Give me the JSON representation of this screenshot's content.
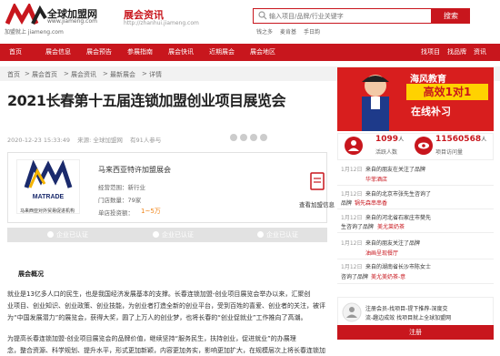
{
  "header": {
    "logo_text": "全球加盟网",
    "logo_url": "www.jiameng.com",
    "slogan": "加盟就上 jiameng.com",
    "section_title": "展会资讯",
    "section_url": "http://zhanhui.jiameng.com",
    "search_placeholder": "输入项目/品牌/行业关键字",
    "search_button": "搜索",
    "hot_keywords": [
      "钱之多",
      "麦肯基",
      "手日韵"
    ]
  },
  "nav": {
    "items": [
      "首页",
      "展会信息",
      "展会预告",
      "参展指南",
      "展会快讯",
      "近期展会",
      "展会地区"
    ],
    "right_items": [
      "找项目",
      "找品牌",
      "资讯"
    ]
  },
  "breadcrumb": [
    "首页",
    "展会首页",
    "展会资讯",
    "最新展会",
    "详情"
  ],
  "article": {
    "title": "2021长春第十五届连锁加盟创业项目展览会",
    "date": "2020-12-23 15:33:49",
    "source": "来源: 全球加盟网",
    "views": "有91人参与"
  },
  "company": {
    "name": "马来西亚特许加盟展会",
    "industry": "经营范围：新行业",
    "stores": "门店数量：79家",
    "invest_label": "单店投资额：",
    "invest_value": "1~5万",
    "logo_caption": "马来西亚对外贸易促进机构",
    "logo_word": "MATRADE",
    "view_info": "查看加盟信息"
  },
  "tabs": [
    "企业已认证",
    "企业已认证",
    "企业已认证"
  ],
  "overview": {
    "heading": "展会概况",
    "para1": [
      "就业是13亿多人口的民生，也是我国经济发展基本的支撑。长春连锁加盟-创业项目展览会举办以来，汇聚创",
      "业项目、创业知识、创业政策、创业技能，为创业者打造全新的创业平台，受到百姓的喜爱、创业者的关注，被评",
      "为“中国发展潜力”的展览会，获得大奖，圆了上万人的创业梦，也将长春的“创业促就业”工作推向了高潮。"
    ],
    "para2": [
      "为提高长春连锁加盟-创业项目展览会的品牌价值，继续坚持“服务民生，扶持创业，促进就业”的办展理",
      "念，整合资源、科学规划、提升水平，形式更加新颖，内容更加务实，影响更加扩大，在规模层次上将长春连锁加"
    ]
  },
  "sidebar": {
    "ad": {
      "line1": "海风教育",
      "line2": "高效1对1",
      "line3": "在线补习"
    },
    "stats": [
      {
        "value": "1099",
        "unit": "人",
        "label": "活跃人数"
      },
      {
        "value": "11560568",
        "unit": "人",
        "label": "项目访问量"
      }
    ],
    "feed": [
      {
        "date": "1月12日",
        "text": "来自的朋友在关注了品牌",
        "brand": "华菲酒店"
      },
      {
        "date": "1月12日",
        "text": "来自湖北省的朋友关注了",
        "brand": ""
      },
      {
        "date": "1月12日",
        "text": "来自的北京市张先生咨询了",
        "brand": ""
      },
      {
        "date": "1月12日",
        "text": "品牌",
        "brand": "锅先森串串香"
      },
      {
        "date": "1月12日",
        "text": "来自的河北省石家庄市樊先",
        "brand": ""
      },
      {
        "date": "1月12日",
        "text": "生咨询了品牌",
        "brand": "美尤莱奶茶"
      },
      {
        "date": "1月12日",
        "text": "来自的朋友关注了品牌",
        "brand": "油画呈现餐厅"
      },
      {
        "date": "1月12日",
        "text": "来自的湖南省长沙市陈女士",
        "brand": ""
      },
      {
        "date": "1月12日",
        "text": "咨询了品牌",
        "brand": "美尤美奶茶-意"
      }
    ],
    "register": {
      "text1": "注册会员-找项目-提下推荐-深度交",
      "text2": "流-趣边成效 找项目就上全球加盟网",
      "button": "注册"
    }
  }
}
